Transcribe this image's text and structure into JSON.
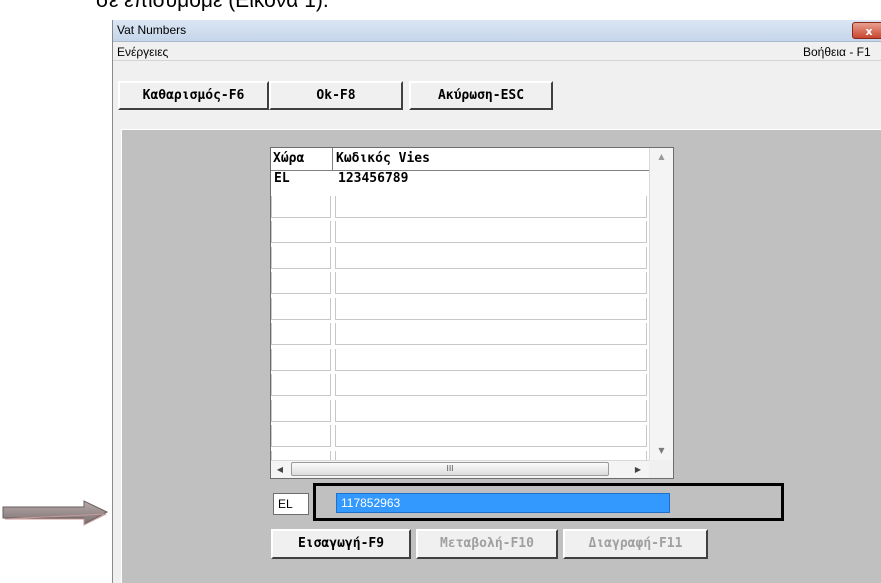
{
  "document": {
    "caption_fragment": "σε επισυμόμε (Εικόνα 1)."
  },
  "window": {
    "title": "Vat Numbers",
    "close_label": "x"
  },
  "menubar": {
    "left_menu": "Ενέργειες",
    "help_menu": "Βοήθεια - F1"
  },
  "toolbar": {
    "clear_label": "Καθαρισμός-F6",
    "ok_label": "Ok-F8",
    "cancel_label": "Ακύρωση-ESC"
  },
  "grid": {
    "columns": [
      "Χώρα",
      "Κωδικός Vies"
    ],
    "rows": [
      [
        "EL",
        "123456789"
      ],
      [
        "",
        ""
      ],
      [
        "",
        ""
      ],
      [
        "",
        ""
      ],
      [
        "",
        ""
      ],
      [
        "",
        ""
      ],
      [
        "",
        ""
      ],
      [
        "",
        ""
      ],
      [
        "",
        ""
      ],
      [
        "",
        ""
      ],
      [
        "",
        ""
      ],
      [
        "",
        ""
      ]
    ],
    "hscroll_thumb_glyph": "III"
  },
  "entry": {
    "country_value": "EL",
    "vat_value": "117852963"
  },
  "actions": {
    "insert_label": "Εισαγωγή-F9",
    "modify_label": "Μεταβολή-F10",
    "delete_label": "Διαγραφή-F11"
  },
  "colors": {
    "selection": "#3399ff",
    "panel": "#c0c0c0",
    "annotation_box": "#000000",
    "arrow": "#8c7f7f"
  }
}
